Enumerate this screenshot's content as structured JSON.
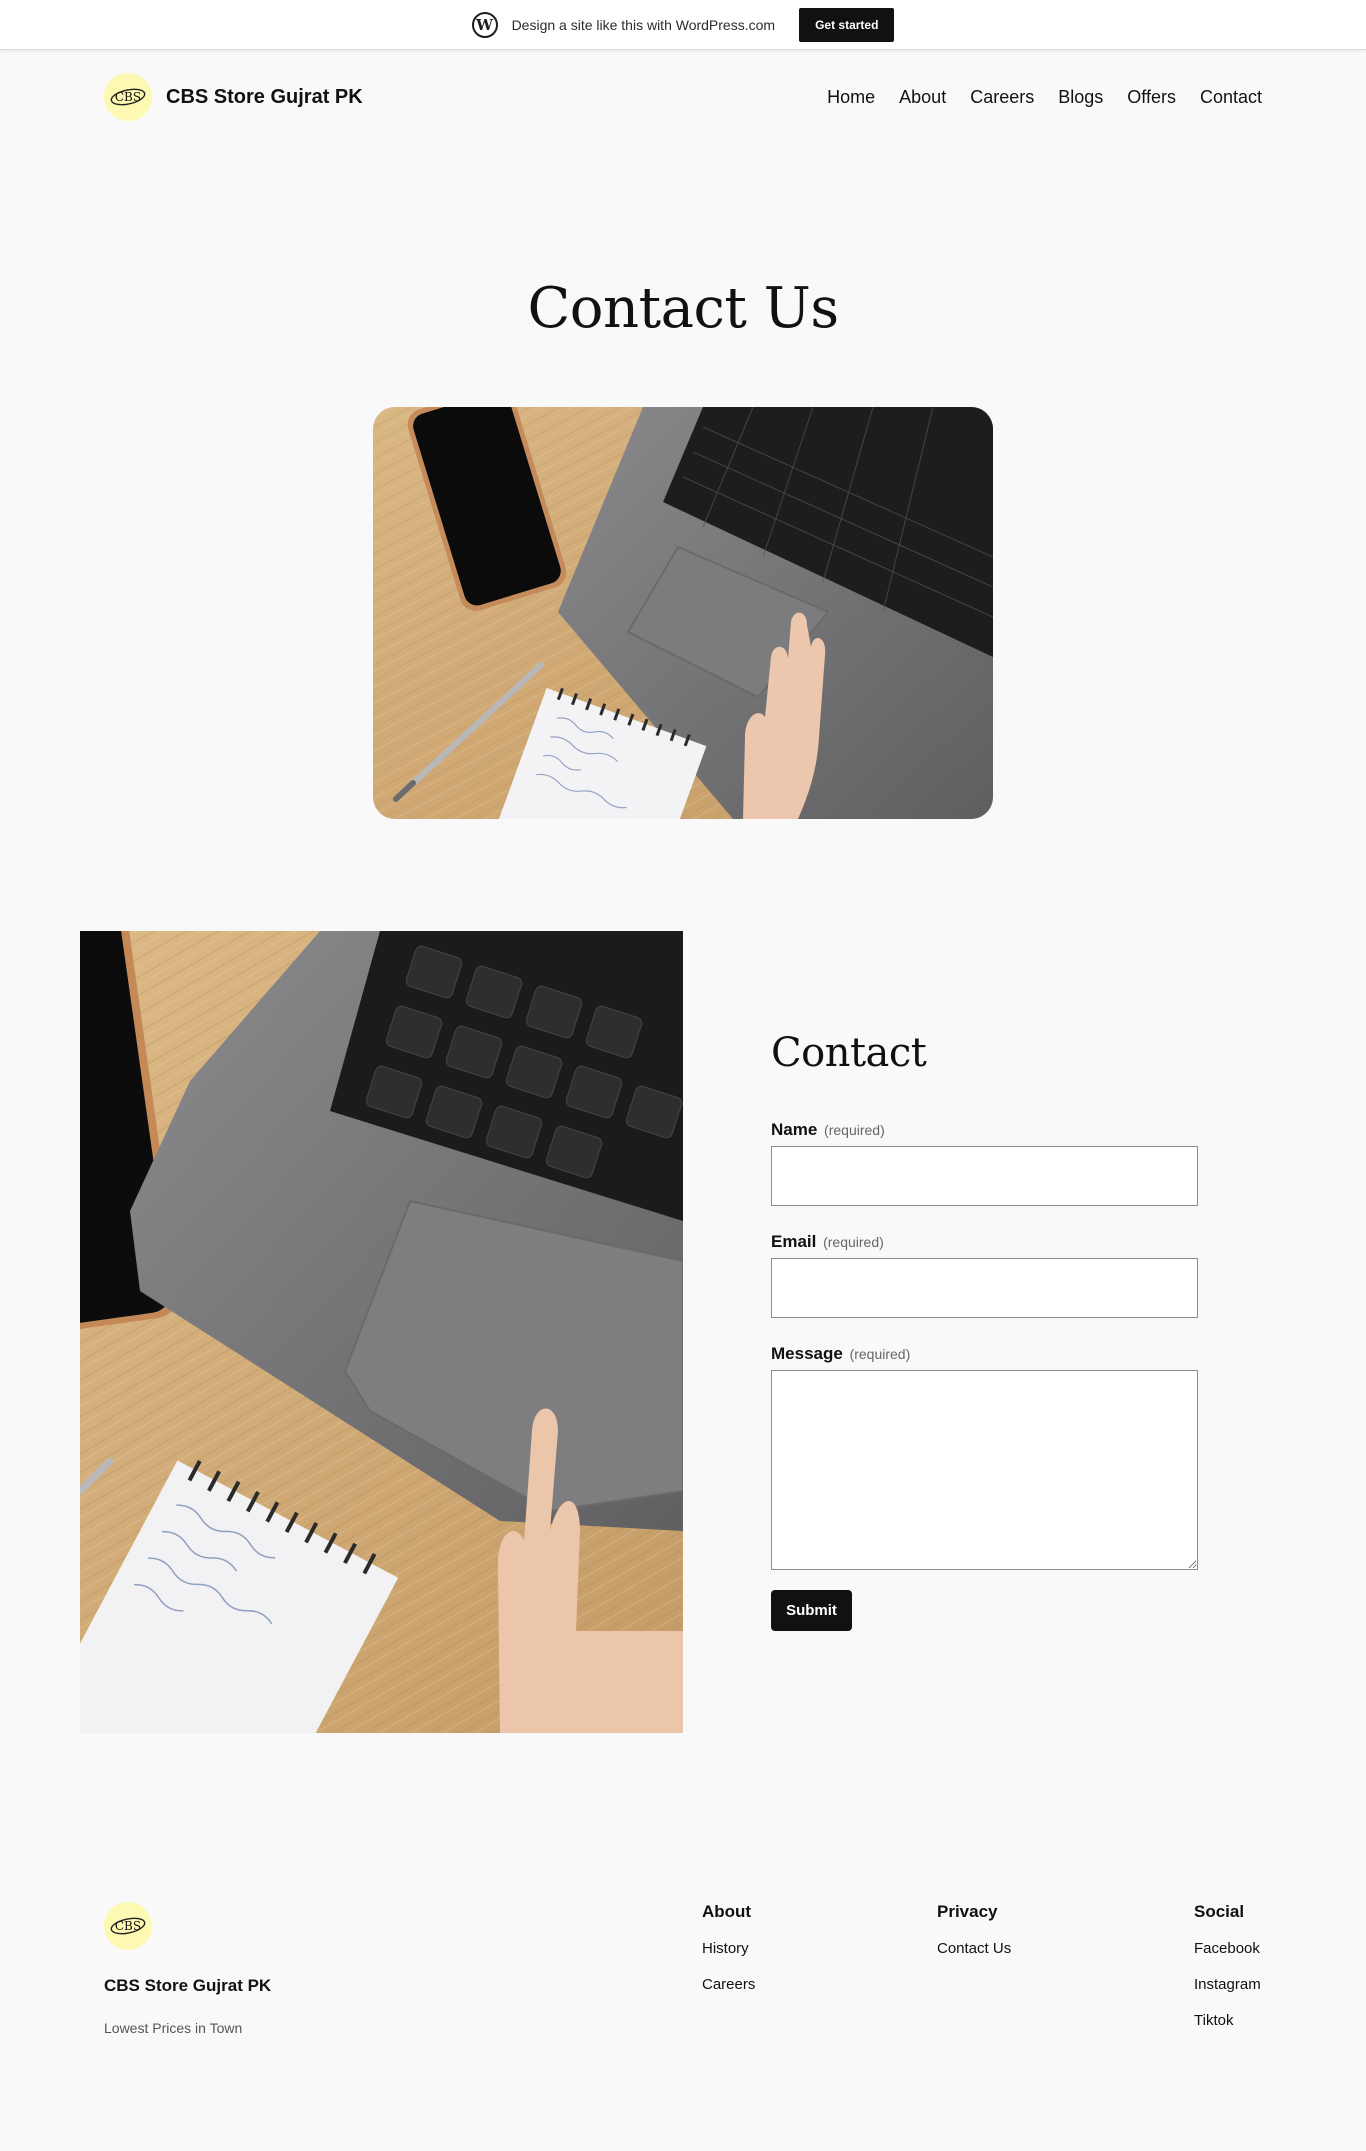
{
  "wpbar": {
    "text": "Design a site like this with WordPress.com",
    "cta": "Get started",
    "logo_icon": "wordpress-logo-icon"
  },
  "header": {
    "site_title": "CBS Store Gujrat PK",
    "logo_text": "CBS",
    "nav": [
      "Home",
      "About",
      "Careers",
      "Blogs",
      "Offers",
      "Contact"
    ]
  },
  "main": {
    "title": "Contact Us",
    "hero_image_icon": "laptop-desk-photo",
    "side_image_icon": "laptop-closeup-photo"
  },
  "form": {
    "title": "Contact",
    "required_text": "(required)",
    "fields": [
      {
        "label": "Name",
        "value": ""
      },
      {
        "label": "Email",
        "value": ""
      },
      {
        "label": "Message",
        "value": ""
      }
    ],
    "submit_label": "Submit"
  },
  "footer": {
    "site_title": "CBS Store Gujrat PK",
    "tagline": "Lowest Prices in Town",
    "columns": [
      {
        "heading": "About",
        "links": [
          "History",
          "Careers"
        ]
      },
      {
        "heading": "Privacy",
        "links": [
          "Contact Us"
        ]
      },
      {
        "heading": "Social",
        "links": [
          "Facebook",
          "Instagram",
          "Tiktok"
        ]
      }
    ]
  },
  "colors": {
    "background": "#f9f9f9",
    "text": "#111111",
    "button": "#111111",
    "logo_bg": "#fdf8b2"
  }
}
